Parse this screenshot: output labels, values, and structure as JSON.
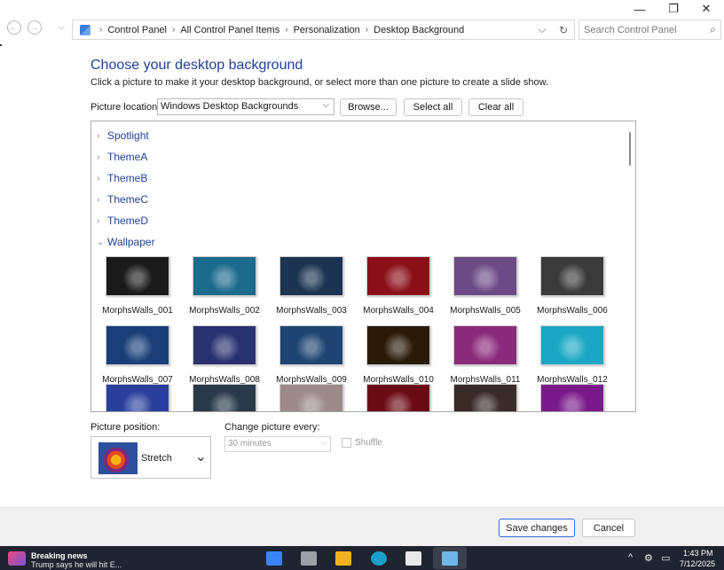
{
  "window": {
    "minimize_glyph": "—",
    "maximize_glyph": "❐",
    "close_glyph": "✕"
  },
  "nav": {
    "back_glyph": "←",
    "forward_glyph": "→",
    "dropdown_glyph": "⌵",
    "breadcrumbs": [
      "Control Panel",
      "All Control Panel Items",
      "Personalization",
      "Desktop Background"
    ],
    "crumb_sep": "›",
    "addr_dropdown_glyph": "⌵",
    "refresh_glyph": "↻",
    "search_placeholder": "Search Control Panel",
    "search_glyph": "⌕"
  },
  "main": {
    "heading": "Choose your desktop background",
    "subtext": "Click a picture to make it your desktop background, or select more than one picture to create a slide show.",
    "location_label": "Picture location:",
    "location_value": "Windows Desktop Backgrounds",
    "browse_label": "Browse...",
    "select_all_label": "Select all",
    "clear_all_label": "Clear all",
    "groups": [
      {
        "label": "Spotlight",
        "caret": "›"
      },
      {
        "label": "ThemeA",
        "caret": "›"
      },
      {
        "label": "ThemeB",
        "caret": "›"
      },
      {
        "label": "ThemeC",
        "caret": "›"
      },
      {
        "label": "ThemeD",
        "caret": "›"
      },
      {
        "label": "Wallpaper",
        "caret": "⌄"
      }
    ],
    "thumbnails": [
      {
        "label": "MorphsWalls_001",
        "color": "#1a1a1a"
      },
      {
        "label": "MorphsWalls_002",
        "color": "#1c6a8c"
      },
      {
        "label": "MorphsWalls_003",
        "color": "#1c3452"
      },
      {
        "label": "MorphsWalls_004",
        "color": "#8a0f18"
      },
      {
        "label": "MorphsWalls_005",
        "color": "#6c4a86"
      },
      {
        "label": "MorphsWalls_006",
        "color": "#3a3a3a"
      },
      {
        "label": "MorphsWalls_007",
        "color": "#1a3f78"
      },
      {
        "label": "MorphsWalls_008",
        "color": "#2a3170"
      },
      {
        "label": "MorphsWalls_009",
        "color": "#1e4572"
      },
      {
        "label": "MorphsWalls_010",
        "color": "#2a1a08"
      },
      {
        "label": "MorphsWalls_011",
        "color": "#8a2a7a"
      },
      {
        "label": "MorphsWalls_012",
        "color": "#1aa6c4"
      },
      {
        "label": "",
        "color": "#2a3f9c"
      },
      {
        "label": "",
        "color": "#2a3a4a"
      },
      {
        "label": "",
        "color": "#9c8a8a"
      },
      {
        "label": "",
        "color": "#6a0a14"
      },
      {
        "label": "",
        "color": "#3a2a2a"
      },
      {
        "label": "",
        "color": "#7a1a8a"
      }
    ],
    "position_label": "Picture position:",
    "position_value": "Stretch",
    "position_chevron": "⌄",
    "change_label": "Change picture every:",
    "change_value": "30 minutes",
    "change_chevron": "⌵",
    "shuffle_label": "Shuffle"
  },
  "footer": {
    "save_label": "Save changes",
    "cancel_label": "Cancel"
  },
  "taskbar": {
    "news_title": "Breaking news",
    "news_sub": "Trump says he will hit E...",
    "tray_chevron": "^",
    "clock_time": "1:43 PM",
    "clock_date": "7/12/2025"
  }
}
